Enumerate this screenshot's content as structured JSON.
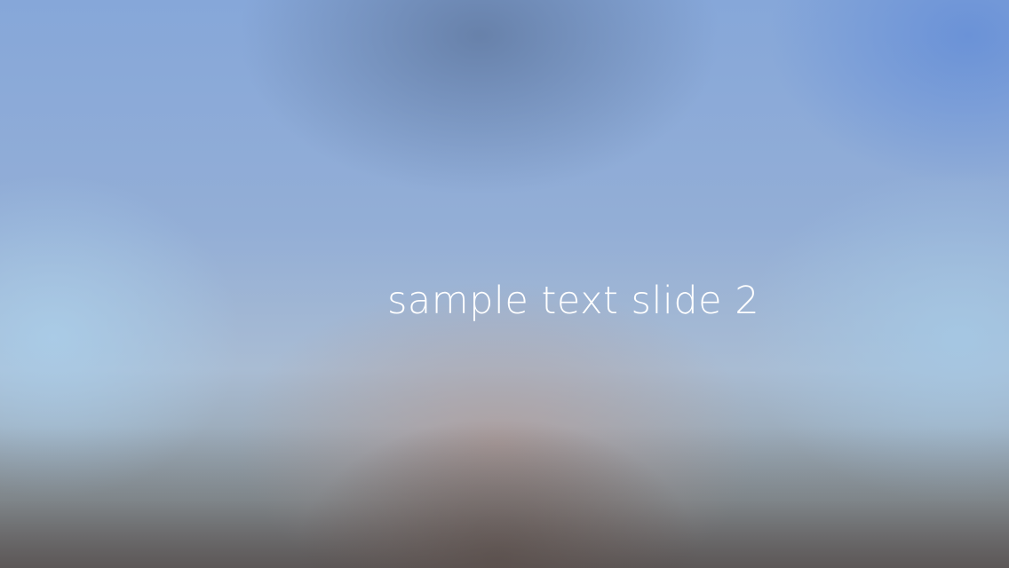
{
  "slide": {
    "caption": "sample text slide 2"
  },
  "colors": {
    "caption_text": "#ffffff",
    "sky_top": "#86a7d9",
    "sky_top_right": "#6991d7",
    "mid_haze": "#a9bcd3",
    "ground_bottom": "#6b6a6c"
  }
}
